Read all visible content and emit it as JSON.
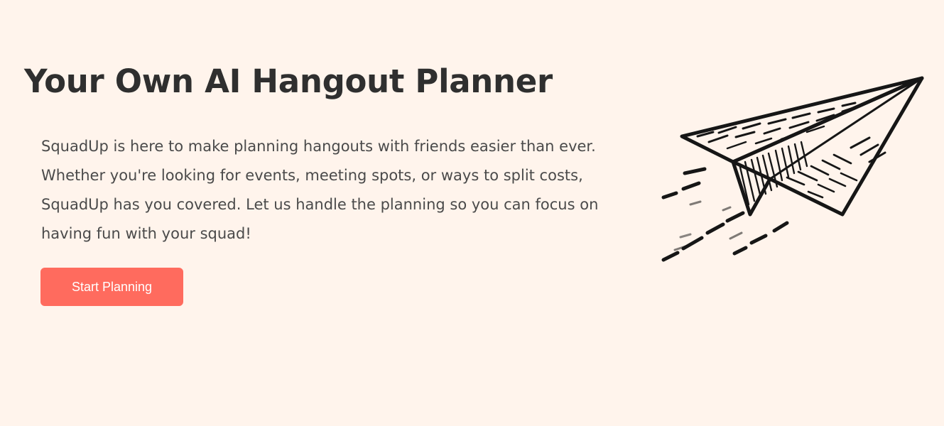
{
  "hero": {
    "title": "Your Own AI Hangout Planner",
    "description": "SquadUp is here to make planning hangouts with friends easier than ever. Whether you're looking for events, meeting spots, or ways to split costs, SquadUp has you covered. Let us handle the planning so you can focus on having fun with your squad!",
    "cta_label": "Start Planning",
    "illustration_icon": "paper-plane-icon"
  },
  "colors": {
    "background": "#fff4ec",
    "title": "#2f2f2f",
    "body_text": "#4a4a4a",
    "button": "#ff6b5e",
    "button_text": "#ffffff"
  }
}
